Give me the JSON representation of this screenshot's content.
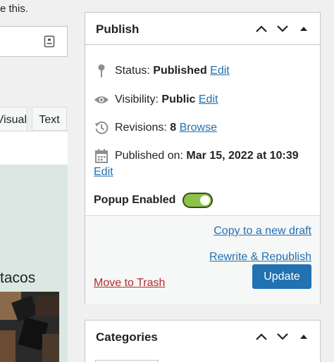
{
  "editor": {
    "note_text": "e this.",
    "tabs": {
      "visual": "Visual",
      "text": "Text"
    },
    "content_heading": "tacos"
  },
  "publish": {
    "title": "Publish",
    "status": {
      "label": "Status:",
      "value": "Published",
      "action": "Edit"
    },
    "visibility": {
      "label": "Visibility:",
      "value": "Public",
      "action": "Edit"
    },
    "revisions": {
      "label": "Revisions:",
      "value": "8",
      "action": "Browse"
    },
    "published_on": {
      "label": "Published on:",
      "value": "Mar 15, 2022 at 10:39",
      "action": "Edit"
    },
    "popup": {
      "label": "Popup Enabled",
      "enabled": true
    },
    "copy_draft": "Copy to a new draft",
    "rewrite_republish": "Rewrite & Republish",
    "move_to_trash": "Move to Trash",
    "update": "Update"
  },
  "categories": {
    "title": "Categories"
  },
  "colors": {
    "link": "#2271b1",
    "danger": "#b32d2e",
    "primary_button": "#2271b1",
    "toggle_on": "#8bc34a",
    "editor_background": "#dae7e3"
  },
  "icons": [
    "pin-icon",
    "eye-icon",
    "history-icon",
    "calendar-icon",
    "chevron-up-icon",
    "chevron-down-icon",
    "collapse-arrow-icon",
    "field-icon"
  ]
}
